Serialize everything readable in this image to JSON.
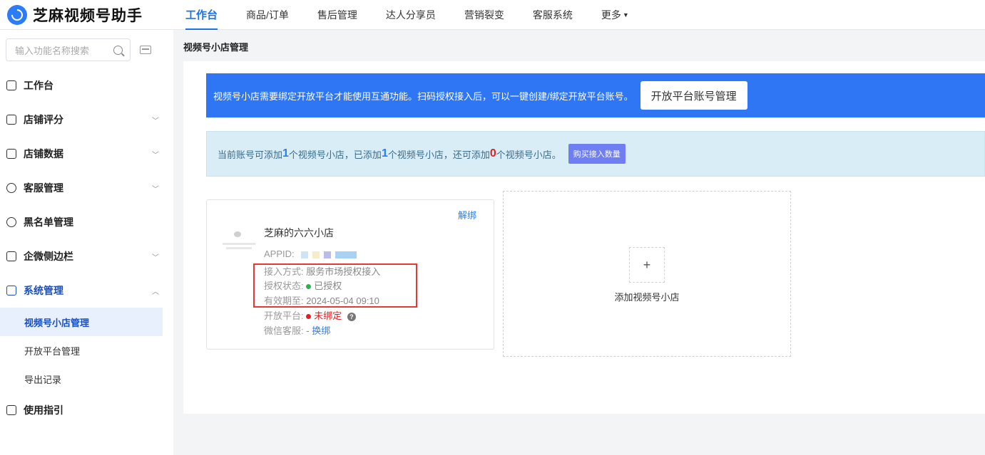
{
  "app": {
    "name": "芝麻视频号助手"
  },
  "topnav": [
    {
      "label": "工作台",
      "active": true
    },
    {
      "label": "商品/订单"
    },
    {
      "label": "售后管理"
    },
    {
      "label": "达人分享员"
    },
    {
      "label": "营销裂变"
    },
    {
      "label": "客服系统"
    },
    {
      "label": "更多"
    }
  ],
  "sidebar": {
    "search_placeholder": "输入功能名称搜索",
    "items": [
      {
        "label": "工作台",
        "icon": "monitor-icon"
      },
      {
        "label": "店铺评分",
        "icon": "shop-icon",
        "expandable": true
      },
      {
        "label": "店铺数据",
        "icon": "chart-icon",
        "expandable": true
      },
      {
        "label": "客服管理",
        "icon": "headset-icon",
        "expandable": true
      },
      {
        "label": "黑名单管理",
        "icon": "user-block-icon"
      },
      {
        "label": "企微侧边栏",
        "icon": "list-icon",
        "expandable": true
      },
      {
        "label": "系统管理",
        "icon": "terminal-icon",
        "expanded": true
      },
      {
        "label": "使用指引",
        "icon": "guide-icon"
      }
    ],
    "sub_items": [
      {
        "label": "视频号小店管理",
        "active": true
      },
      {
        "label": "开放平台管理"
      },
      {
        "label": "导出记录"
      }
    ]
  },
  "main": {
    "title": "视频号小店管理",
    "banner_text": "视频号小店需要绑定开放平台才能使用互通功能。扫码授权接入后，可以一键创建/绑定开放平台账号。",
    "banner_button": "开放平台账号管理",
    "info": {
      "p1": "当前账号可添加",
      "n1": "1",
      "p2": "个视频号小店，已添加",
      "n2": "1",
      "p3": "个视频号小店，还可添加",
      "n3": "0",
      "p4": "个视频号小店。",
      "button": "购买接入数量"
    },
    "shop_card": {
      "unbind": "解绑",
      "name": "芝麻的六六小店",
      "appid_label": "APPID:",
      "access_label": "接入方式:",
      "access_value": "服务市场授权接入",
      "auth_label": "授权状态:",
      "auth_value": "已授权",
      "expire_label": "有效期至:",
      "expire_value": "2024-05-04 09:10",
      "platform_label": "开放平台:",
      "platform_value": "未绑定",
      "wechat_label": "微信客服:",
      "wechat_value": "-",
      "wechat_link": "换绑"
    },
    "add_card": {
      "label": "添加视频号小店",
      "plus": "+"
    }
  },
  "colors": {
    "accent": "#2b7cf6",
    "banner": "#2f76f5",
    "info_bg": "#d9edf7",
    "danger": "#e02020",
    "success": "#2bb24c"
  }
}
